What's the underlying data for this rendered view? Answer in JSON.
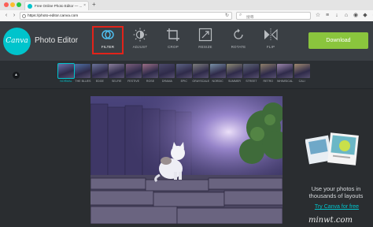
{
  "browser": {
    "tab_title": "Free Online Photo Editor — ...",
    "tab_close": "×",
    "new_tab": "+",
    "url": "https://photo-editor.canva.com",
    "search_placeholder": "搜尋",
    "nav_back": "‹",
    "nav_forward": "›",
    "reload": "↻"
  },
  "header": {
    "logo_text": "Canva",
    "app_title": "Photo Editor",
    "download_label": "Download",
    "tools": [
      {
        "label": "FILTER",
        "icon": "filter-circles-icon"
      },
      {
        "label": "ADJUST",
        "icon": "adjust-sun-icon"
      },
      {
        "label": "CROP",
        "icon": "crop-icon"
      },
      {
        "label": "RESIZE",
        "icon": "resize-icon"
      },
      {
        "label": "ROTATE",
        "icon": "rotate-icon"
      },
      {
        "label": "FLIP",
        "icon": "flip-icon"
      }
    ],
    "active_tool": "FILTER"
  },
  "filters": {
    "collapse_glyph": "▲",
    "items": [
      {
        "label": "NORMAL",
        "color": "#6a6fa8",
        "active": true
      },
      {
        "label": "THE BLUES",
        "color": "#4f6fa3"
      },
      {
        "label": "EDGE",
        "color": "#6b7398"
      },
      {
        "label": "SELFIE",
        "color": "#8a7f9b"
      },
      {
        "label": "FESTIVE",
        "color": "#7a5e7b"
      },
      {
        "label": "ROSE",
        "color": "#9b6e86"
      },
      {
        "label": "DRAMA",
        "color": "#4c4a6a"
      },
      {
        "label": "EPIC",
        "color": "#5d6383"
      },
      {
        "label": "GRAYSCALE",
        "color": "#7d7d7d"
      },
      {
        "label": "NORDIC",
        "color": "#7990a6"
      },
      {
        "label": "SUMMER",
        "color": "#8d8a73"
      },
      {
        "label": "STREET",
        "color": "#5f6577"
      },
      {
        "label": "RETRO",
        "color": "#8f7f6a"
      },
      {
        "label": "WHIMSICAL",
        "color": "#9c86ab"
      },
      {
        "label": "CALI",
        "color": "#a0896f"
      }
    ]
  },
  "promo": {
    "text": "Use your photos in thousands of layouts",
    "link": "Try Canva for free"
  },
  "watermark": "minwt.com",
  "colors": {
    "accent": "#00c4cc",
    "download": "#8ac53d",
    "highlight_box": "#e2231a"
  }
}
